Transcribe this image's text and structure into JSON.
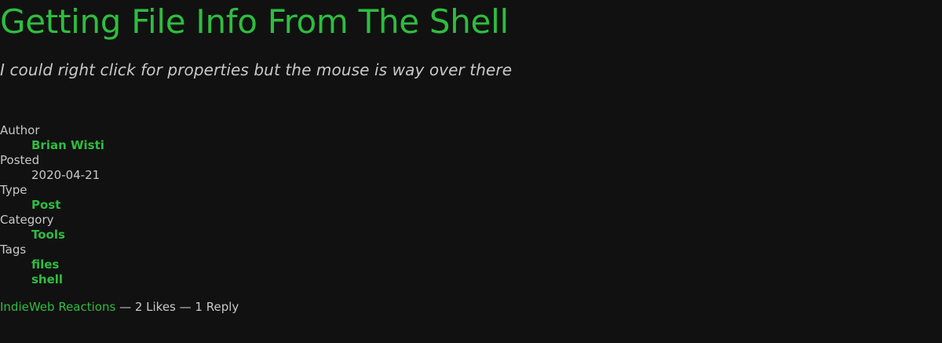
{
  "post": {
    "title": "Getting File Info From The Shell",
    "subtitle": "I could right click for properties but the mouse is way over there"
  },
  "meta": {
    "author_label": "Author",
    "author": "Brian Wisti",
    "posted_label": "Posted",
    "posted": "2020-04-21",
    "type_label": "Type",
    "type": "Post",
    "category_label": "Category",
    "category": "Tools",
    "tags_label": "Tags",
    "tags": [
      "files",
      "shell"
    ]
  },
  "reactions": {
    "link_label": "IndieWeb Reactions",
    "separator": " — ",
    "likes": "2 Likes",
    "replies": "1 Reply"
  },
  "colors": {
    "background": "#111111",
    "accent": "#2ebd3f",
    "text": "#c8c8c8"
  }
}
